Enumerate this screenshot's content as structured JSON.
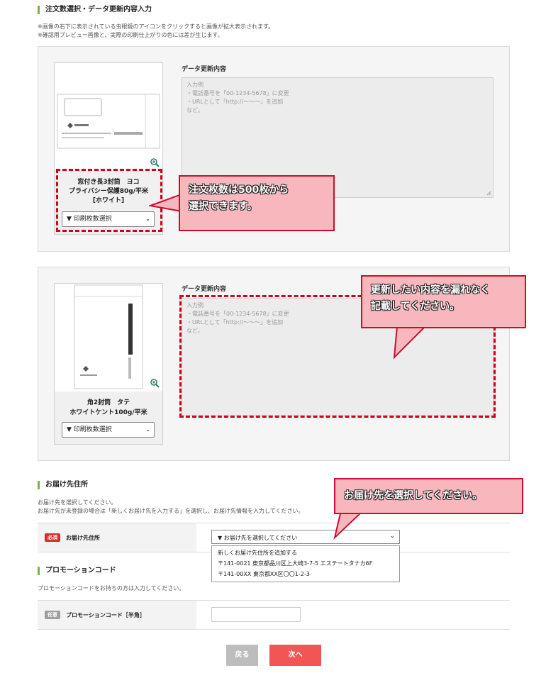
{
  "section1": {
    "title": "注文数選択・データ更新内容入力",
    "note1": "※画像の右下に表示されている虫眼鏡のアイコンをクリックすると画像が拡大表示されます。",
    "note2": "※確認用プレビュー画像と、実際の印刷仕上がりの色には差が生じます。"
  },
  "product1": {
    "name_line1": "窓付き長3封筒　ヨコ",
    "name_line2": "プライバシー保護80g/平米",
    "name_line3": "[ホワイト]",
    "select_label": "▼ 印刷枚数選択",
    "data_label": "データ更新内容",
    "placeholder_lines": [
      "入力例",
      "・電話番号を「00-1234-5678」に変更",
      "・URLとして「http://〜〜〜」を追加",
      "など。"
    ]
  },
  "product2": {
    "name_line1": "角2封筒　タテ",
    "name_line2": "ホワイトケント100g/平米",
    "select_label": "▼ 印刷枚数選択",
    "data_label": "データ更新内容",
    "placeholder_lines": [
      "入力例",
      "・電話番号を「00-1234-5678」に変更",
      "・URLとして「http://〜〜〜」を追加",
      "など。"
    ]
  },
  "callouts": {
    "c1_line1": "注文枚数は500枚から",
    "c1_line2": "選択できます。",
    "c2_line1": "更新したい内容を漏れなく",
    "c2_line2": "記載してください。",
    "c3": "お届け先を選択してください。"
  },
  "delivery": {
    "title": "お届け先住所",
    "note1": "お届け先を選択してください。",
    "note2": "お届け先が未登録の場合は「新しくお届け先を入力する」を選択し、お届け先情報を入力してください。",
    "badge": "必須",
    "label": "お届け先住所",
    "select_label": "▼ お届け先を選択してください",
    "options": [
      "新しくお届け先住所を追加する",
      "〒141-0021 東京都品川区上大崎3-7-5 エステートタナカ6F",
      "〒141-00XX 東京都XX区〇〇1-2-3"
    ]
  },
  "promo": {
    "title": "プロモーションコード",
    "note": "プロモーションコードをお持ちの方は入力してください。",
    "badge": "任意",
    "label": "プロモーションコード［半角］",
    "input_value": ""
  },
  "buttons": {
    "back": "戻る",
    "next": "次へ"
  },
  "colors": {
    "accent_green": "#7cb342",
    "alert_red": "#d0021b",
    "callout_pink": "#f8b7bd",
    "next_button": "#f15555"
  }
}
